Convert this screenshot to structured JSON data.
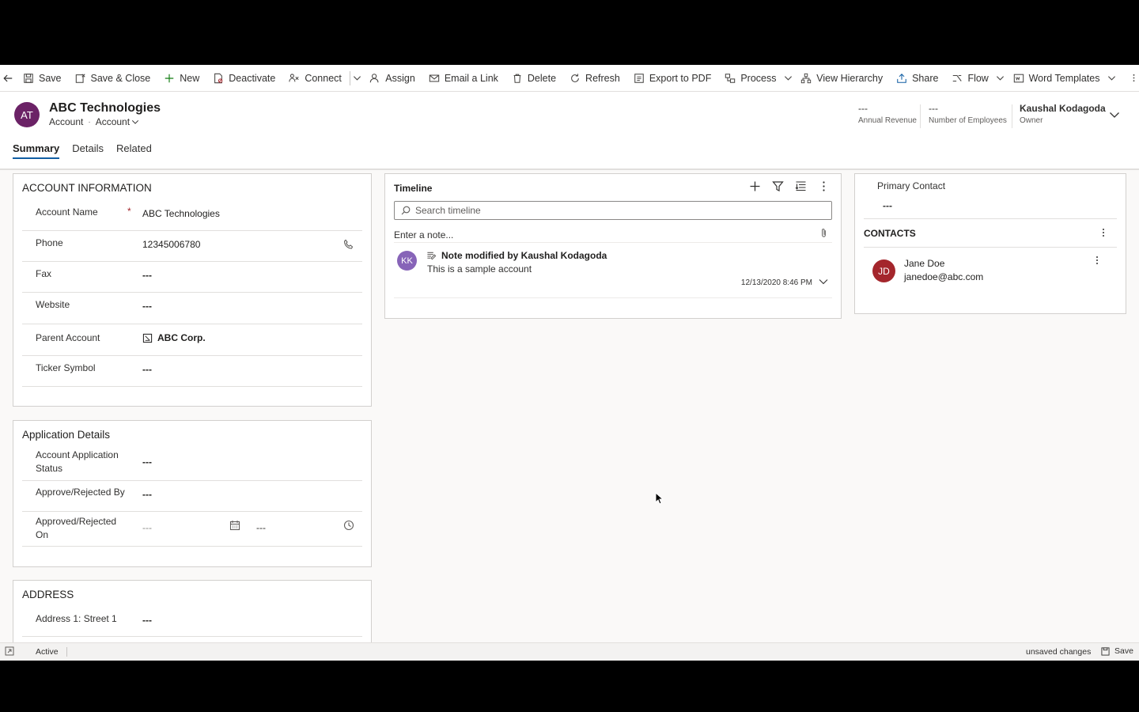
{
  "command_bar": {
    "items": [
      {
        "label": "Save",
        "icon": "save-icon"
      },
      {
        "label": "Save & Close",
        "icon": "save-close-icon"
      },
      {
        "label": "New",
        "icon": "plus-icon"
      },
      {
        "label": "Deactivate",
        "icon": "deactivate-icon"
      },
      {
        "label": "Connect",
        "icon": "connect-icon"
      },
      {
        "label": "Assign",
        "icon": "assign-icon"
      },
      {
        "label": "Email a Link",
        "icon": "email-icon"
      },
      {
        "label": "Delete",
        "icon": "delete-icon"
      },
      {
        "label": "Refresh",
        "icon": "refresh-icon"
      },
      {
        "label": "Export to PDF",
        "icon": "pdf-icon"
      },
      {
        "label": "Process",
        "icon": "process-icon"
      },
      {
        "label": "View Hierarchy",
        "icon": "hierarchy-icon"
      },
      {
        "label": "Share",
        "icon": "share-icon"
      },
      {
        "label": "Flow",
        "icon": "flow-icon"
      },
      {
        "label": "Word Templates",
        "icon": "word-icon"
      }
    ]
  },
  "header": {
    "avatar_initials": "AT",
    "avatar_color": "#6b2266",
    "title": "ABC Technologies",
    "entity": "Account",
    "form": "Account",
    "fields": [
      {
        "value": "---",
        "label": "Annual Revenue"
      },
      {
        "value": "---",
        "label": "Number of Employees"
      },
      {
        "value": "Kaushal Kodagoda",
        "label": "Owner"
      }
    ],
    "tabs": [
      "Summary",
      "Details",
      "Related"
    ],
    "active_tab": "Summary"
  },
  "account_information": {
    "title": "ACCOUNT INFORMATION",
    "fields": [
      {
        "label": "Account Name",
        "value": "ABC Technologies",
        "required": "*"
      },
      {
        "label": "Phone",
        "value": "12345006780"
      },
      {
        "label": "Fax",
        "value": "---"
      },
      {
        "label": "Website",
        "value": "---"
      },
      {
        "label": "Parent Account",
        "value": "ABC Corp."
      },
      {
        "label": "Ticker Symbol",
        "value": "---"
      }
    ]
  },
  "application_details": {
    "title": "Application Details",
    "fields": [
      {
        "label": "Account Application Status",
        "value": "---"
      },
      {
        "label": "Approve/Rejected By",
        "value": "---"
      },
      {
        "label": "Approved/Rejected On",
        "date": "---",
        "time": "---"
      }
    ]
  },
  "address": {
    "title": "ADDRESS",
    "fields": [
      {
        "label": "Address 1: Street 1",
        "value": "---"
      }
    ]
  },
  "timeline": {
    "title": "Timeline",
    "search_placeholder": "Search timeline",
    "note_placeholder": "Enter a note...",
    "entries": [
      {
        "initials": "KK",
        "title": "Note modified by Kaushal Kodagoda",
        "body": "This is a sample account",
        "timestamp": "12/13/2020 8:46 PM"
      }
    ]
  },
  "right_column": {
    "primary_contact_label": "Primary Contact",
    "primary_contact_value": "---",
    "contacts_title": "CONTACTS",
    "contacts": [
      {
        "initials": "JD",
        "name": "Jane Doe",
        "email": "janedoe@abc.com"
      }
    ]
  },
  "status_bar": {
    "status": "Active",
    "unsaved": "unsaved changes",
    "save_label": "Save"
  }
}
